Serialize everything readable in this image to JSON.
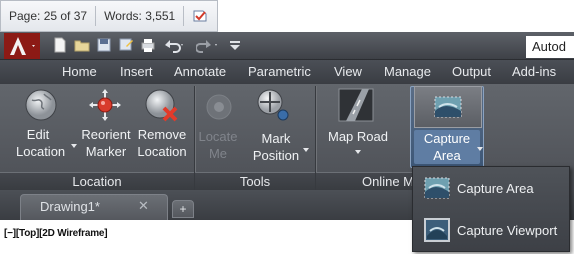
{
  "word_status": {
    "page": "Page: 25 of 37",
    "words": "Words: 3,551",
    "proofing_icon": "proofing-check-icon"
  },
  "app": {
    "title_partial": "Autod",
    "logo_icon": "autocad-logo-icon"
  },
  "qat": {
    "icons": [
      "new-icon",
      "open-icon",
      "save-icon",
      "save-as-icon",
      "print-icon",
      "undo-icon",
      "redo-icon",
      "customize-icon"
    ]
  },
  "ribbon_tabs": [
    "Home",
    "Insert",
    "Annotate",
    "Parametric",
    "View",
    "Manage",
    "Output",
    "Add-ins"
  ],
  "panels": {
    "location": {
      "title": "Location",
      "edit_location": [
        "Edit",
        "Location"
      ],
      "reorient_marker": [
        "Reorient",
        "Marker"
      ],
      "remove_location": [
        "Remove",
        "Location"
      ]
    },
    "tools": {
      "title": "Tools",
      "locate_me": [
        "Locate",
        "Me"
      ],
      "mark_position": [
        "Mark",
        "Position"
      ]
    },
    "online_map": {
      "title": "Online M",
      "map_road": "Map Road",
      "capture_area": [
        "Capture",
        "Area"
      ]
    }
  },
  "doc_tabs": {
    "drawing": "Drawing1*",
    "close": "✕",
    "new_tab": "+"
  },
  "viewport": {
    "label": "[−][Top][2D Wireframe]"
  },
  "capture_menu": {
    "items": [
      {
        "label": "Capture Area",
        "icon": "capture-area-icon"
      },
      {
        "label": "Capture Viewport",
        "icon": "capture-viewport-icon"
      }
    ]
  }
}
